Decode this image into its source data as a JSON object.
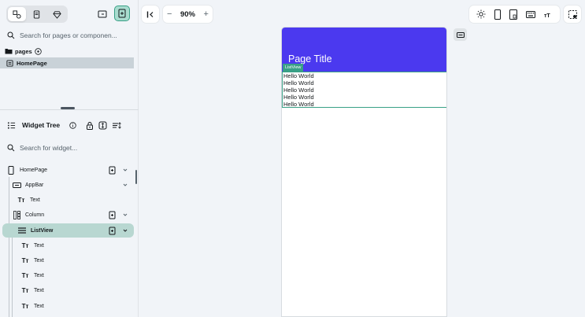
{
  "left_panel": {
    "search_pages_placeholder": "Search for pages or componen...",
    "pages_label": "pages",
    "page_item": "HomePage",
    "widget_tree_label": "Widget Tree",
    "search_widget_placeholder": "Search for widget...",
    "tree": [
      {
        "label": "HomePage",
        "icon": "phone-icon"
      },
      {
        "label": "AppBar",
        "icon": "appbar-icon"
      },
      {
        "label": "Text",
        "icon": "text-icon"
      },
      {
        "label": "Column",
        "icon": "column-icon"
      },
      {
        "label": "ListView",
        "icon": "list-icon"
      },
      {
        "label": "Text",
        "icon": "text-icon"
      },
      {
        "label": "Text",
        "icon": "text-icon"
      },
      {
        "label": "Text",
        "icon": "text-icon"
      },
      {
        "label": "Text",
        "icon": "text-icon"
      },
      {
        "label": "Text",
        "icon": "text-icon"
      }
    ]
  },
  "toolbar": {
    "zoom_minus": "−",
    "zoom_value": "90%",
    "zoom_plus": "+"
  },
  "device": {
    "appbar_title": "Page Title",
    "listview_badge": "ListView",
    "list_items": [
      "Hello World",
      "Hello World",
      "Hello World",
      "Hello World",
      "Hello World"
    ]
  },
  "colors": {
    "primary": "#4b39ef",
    "accent": "#39a086",
    "selected_row": "#b8d7d1"
  }
}
